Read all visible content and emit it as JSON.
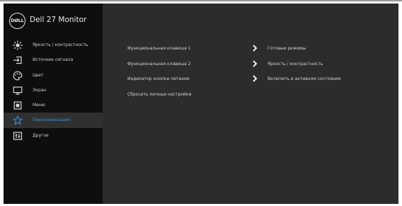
{
  "header": {
    "logo_text": "DØLL",
    "title": "Dell 27 Monitor"
  },
  "sidebar": {
    "items": [
      {
        "label": "Яркость / контрастность",
        "icon": "brightness-icon"
      },
      {
        "label": "Источник сигнала",
        "icon": "input-source-icon"
      },
      {
        "label": "Цвет",
        "icon": "color-palette-icon"
      },
      {
        "label": "Экран",
        "icon": "display-icon"
      },
      {
        "label": "Меню",
        "icon": "menu-icon"
      },
      {
        "label": "Персонализация",
        "icon": "star-icon",
        "active": true
      },
      {
        "label": "Другое",
        "icon": "others-icon"
      }
    ]
  },
  "content": {
    "rows": [
      {
        "label": "Функциональная клавиша 1",
        "value": "Готовые режимы"
      },
      {
        "label": "Функциональная клавиша 2",
        "value": "Яркость / контрастность"
      },
      {
        "label": "Индикатор кнопки питания",
        "value": "Включить в активном состоянии"
      },
      {
        "label": "Сбросить личные настройки",
        "value": ""
      }
    ]
  },
  "colors": {
    "accent": "#3e8fd6",
    "sidebar_bg": "#0e0e0e",
    "content_bg": "#2c2c2c"
  }
}
